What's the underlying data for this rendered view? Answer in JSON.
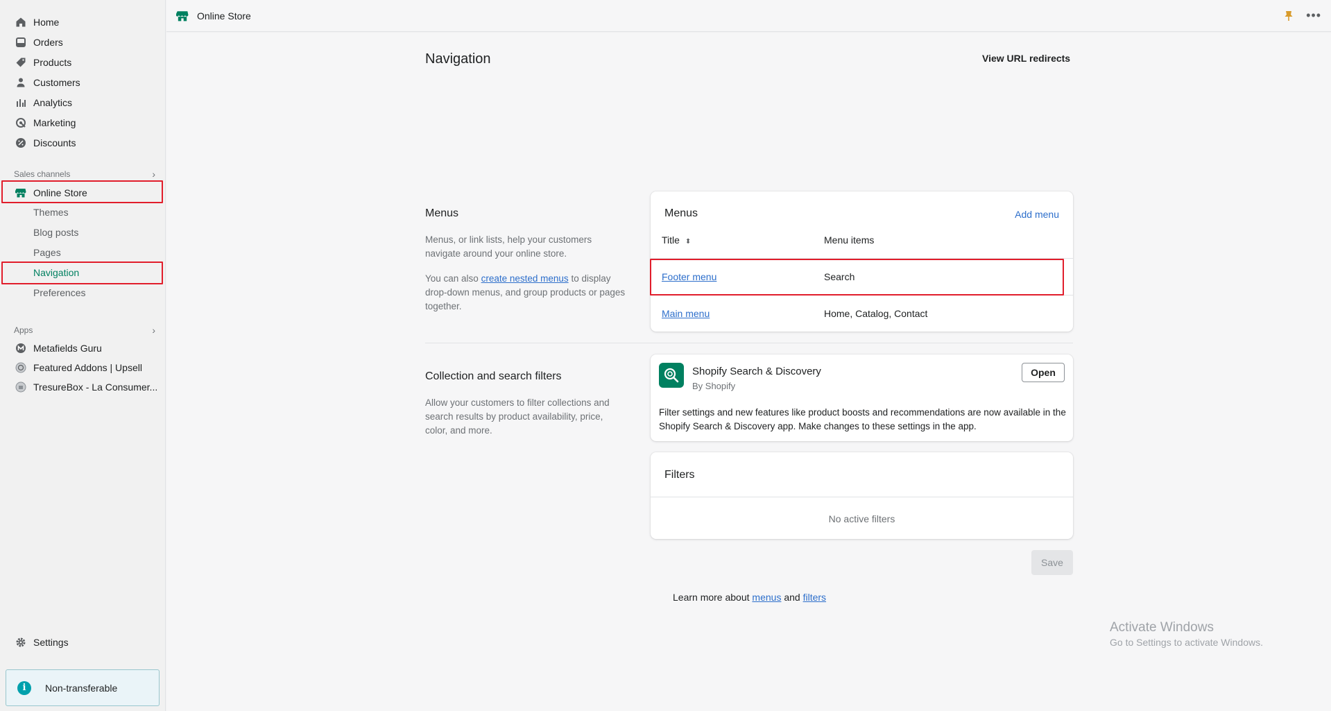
{
  "sidebar": {
    "items": [
      {
        "label": "Home",
        "icon": "home-icon"
      },
      {
        "label": "Orders",
        "icon": "orders-icon"
      },
      {
        "label": "Products",
        "icon": "tag-icon"
      },
      {
        "label": "Customers",
        "icon": "person-icon"
      },
      {
        "label": "Analytics",
        "icon": "bar-chart-icon"
      },
      {
        "label": "Marketing",
        "icon": "target-icon"
      },
      {
        "label": "Discounts",
        "icon": "discount-icon"
      }
    ],
    "sales_channels_label": "Sales channels",
    "online_store_label": "Online Store",
    "online_store_sub": [
      "Themes",
      "Blog posts",
      "Pages",
      "Navigation",
      "Preferences"
    ],
    "apps_label": "Apps",
    "apps": [
      "Metafields Guru",
      "Featured Addons | Upsell",
      "TresureBox - La Consumer..."
    ],
    "settings_label": "Settings",
    "non_transferable": "Non-transferable",
    "accent_color": "#008060"
  },
  "topbar": {
    "title": "Online Store",
    "more": "•••"
  },
  "page": {
    "title": "Navigation",
    "url_redirects": "View URL redirects"
  },
  "menus_section": {
    "heading": "Menus",
    "desc1": "Menus, or link lists, help your customers navigate around your online store.",
    "desc2_pre": "You can also",
    "desc2_link": "create nested menus",
    "desc2_post": "to display drop-down menus, and group products or pages together.",
    "card_title": "Menus",
    "add_menu": "Add menu",
    "col_title": "Title",
    "col_items": "Menu items",
    "rows": [
      {
        "title": "Footer menu",
        "items": "Search"
      },
      {
        "title": "Main menu",
        "items": "Home, Catalog, Contact"
      }
    ]
  },
  "filters_section": {
    "heading": "Collection and search filters",
    "desc": "Allow your customers to filter collections and search results by product availability, price, color, and more.",
    "app_name": "Shopify Search & Discovery",
    "app_by": "By Shopify",
    "open_label": "Open",
    "app_desc": "Filter settings and new features like product boosts and recommendations are now available in the Shopify Search & Discovery app. Make changes to these settings in the app.",
    "filters_title": "Filters",
    "no_filters": "No active filters"
  },
  "save_label": "Save",
  "learn_more": {
    "pre": "Learn more about",
    "menus": "menus",
    "and": "and",
    "filters": "filters"
  },
  "watermark": {
    "line1": "Activate Windows",
    "line2": "Go to Settings to activate Windows."
  },
  "highlight_color": "#e11d2b"
}
